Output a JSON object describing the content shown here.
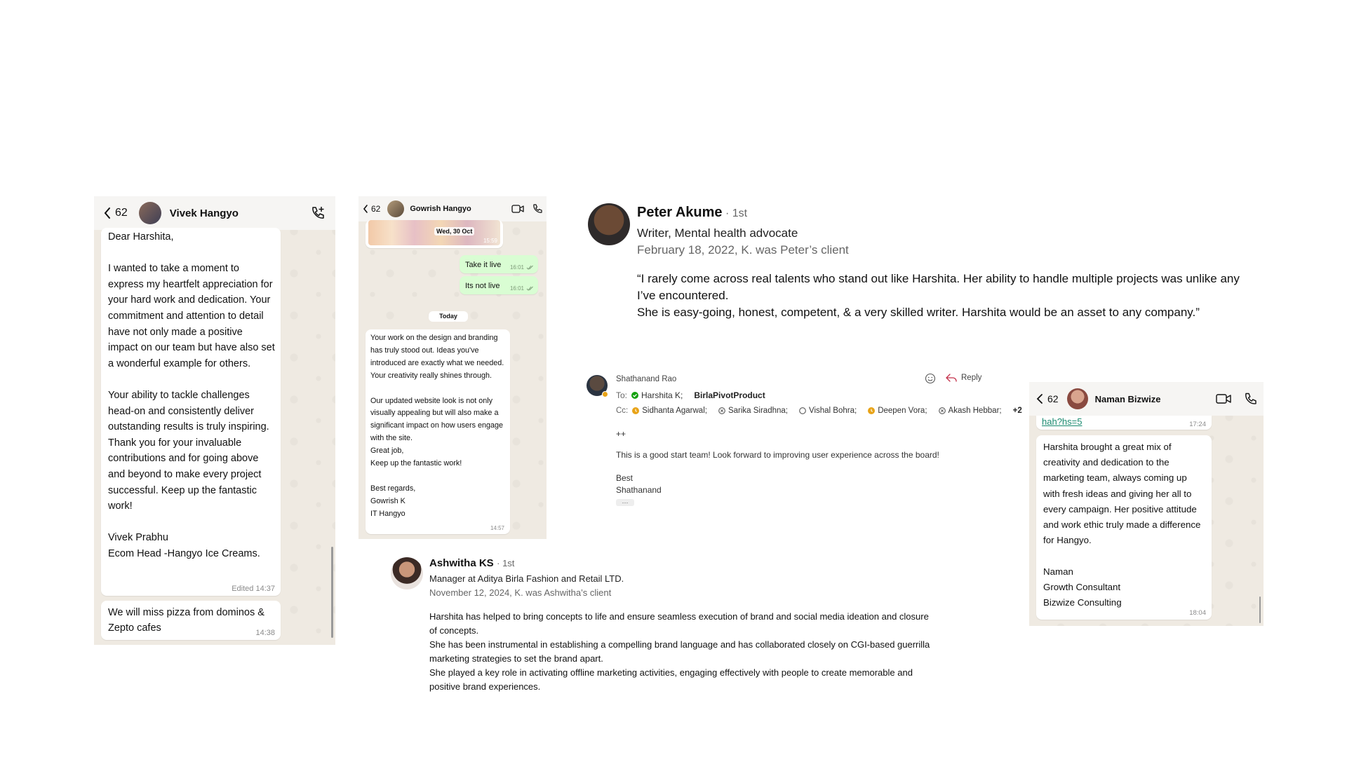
{
  "chat1": {
    "back_count": "62",
    "contact_name": "Vivek Hangyo",
    "message": "Dear Harshita,\n\nI wanted to take a moment to express my heartfelt appreciation for your hard work and dedication. Your commitment and attention to detail have not only made a positive impact on our team but have also set a wonderful example for others.\n\nYour ability to tackle challenges head-on and consistently deliver outstanding results is truly inspiring. Thank you for your invaluable contributions and for going above and beyond to make every project successful. Keep up the fantastic work!\n\nVivek Prabhu\nEcom Head -Hangyo Ice Creams.",
    "message_time": "Edited 14:37",
    "message2": "We will miss pizza from dominos &\nZepto cafes",
    "message2_time": "14:38"
  },
  "chat2": {
    "back_count": "62",
    "contact_name": "Gowrish Hangyo",
    "image_date": "Wed, 30 Oct",
    "image_time": "15:59",
    "out_messages": [
      {
        "text": "Take it live",
        "time": "16:01"
      },
      {
        "text": "Its not live",
        "time": "16:01"
      }
    ],
    "day_divider": "Today",
    "message": "Your work on the design and branding has truly stood out. Ideas you've introduced are exactly what we needed. Your creativity really shines through.\n\nOur updated website look is not only visually appealing but will also make a significant impact on how users engage with the site.\nGreat job,\nKeep up the fantastic work!\n\nBest regards,\nGowrish K\nIT Hangyo",
    "message_time": "14:57"
  },
  "linkedin1": {
    "name": "Peter Akume",
    "degree": "· 1st",
    "headline": "Writer, Mental health advocate",
    "meta": "February 18, 2022, K. was Peter’s client",
    "quote": "“I rarely come across real talents who stand out like Harshita. Her ability to handle multiple projects was unlike any I’ve encountered.\nShe is easy-going, honest, competent, & a very skilled writer. Harshita would be an asset to any company.”"
  },
  "email": {
    "sender": "Shathanand Rao",
    "reply_label": "Reply",
    "to_label": "To:",
    "to": [
      {
        "name": "Harshita K;",
        "status": "available"
      },
      {
        "name": "BirlaPivotProduct",
        "status": "group"
      }
    ],
    "cc_label": "Cc:",
    "cc": [
      {
        "name": "Sidhanta Agarwal;",
        "status": "away"
      },
      {
        "name": "Sarika Siradhna;",
        "status": "offline-x"
      },
      {
        "name": "Vishal Bohra;",
        "status": "offline"
      },
      {
        "name": "Deepen Vora;",
        "status": "away"
      },
      {
        "name": "Akash Hebbar;",
        "status": "offline-x"
      }
    ],
    "cc_more": "+2",
    "body_plus": "++",
    "body": "This is a good start team! Look forward to improving user experience across the board!",
    "signoff": "Best\nShathanand",
    "ellipsis": "···",
    "colors": {
      "available": "#13a10e",
      "away": "#e8a317",
      "reply": "#c4314b"
    }
  },
  "linkedin2": {
    "name": "Ashwitha KS",
    "degree": "· 1st",
    "headline": "Manager at Aditya Birla Fashion and Retail LTD.",
    "meta": "November 12, 2024, K. was Ashwitha’s client",
    "quote": "Harshita has helped to bring concepts to life and ensure seamless execution of brand and social media ideation and closure of concepts.\nShe has been instrumental in establishing a compelling brand language and has collaborated closely on CGI-based guerrilla marketing strategies to set the brand apart.\nShe played a key role in activating offline marketing activities, engaging effectively with people to create memorable and positive brand experiences."
  },
  "chat3": {
    "back_count": "62",
    "contact_name": "Naman Bizwize",
    "link_text": "hah?hs=5",
    "link_time": "17:24",
    "message": "Harshita brought a great mix of creativity and dedication to the marketing team, always coming up with fresh ideas and giving her all to every campaign. Her positive attitude and work ethic truly made a difference for Hangyo.\n\nNaman\nGrowth Consultant\nBizwize Consulting",
    "message_time": "18:04"
  }
}
